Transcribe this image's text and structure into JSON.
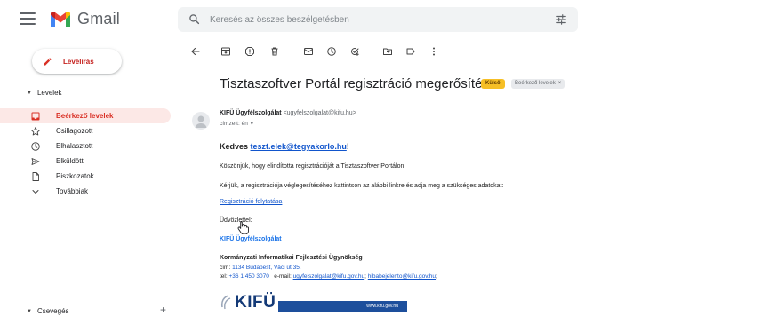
{
  "app": {
    "name": "Gmail",
    "colors": {
      "accent_red": "#d93025",
      "active_bg": "#fce8e6",
      "link": "#1155cc",
      "badge_external": "#f6bf26"
    }
  },
  "search": {
    "placeholder": "Keresés az összes beszélgetésben",
    "value": ""
  },
  "compose": {
    "label": "Levélírás"
  },
  "sidebar": {
    "section_title": "Levelek",
    "items": [
      {
        "label": "Beérkező levelek",
        "icon": "inbox-icon",
        "active": true
      },
      {
        "label": "Csillagozott",
        "icon": "star-icon",
        "active": false
      },
      {
        "label": "Elhalasztott",
        "icon": "clock-icon",
        "active": false
      },
      {
        "label": "Elküldött",
        "icon": "send-icon",
        "active": false
      },
      {
        "label": "Piszkozatok",
        "icon": "draft-icon",
        "active": false
      },
      {
        "label": "Továbbiak",
        "icon": "chevron-down-icon",
        "active": false
      }
    ],
    "chat_title": "Csevegés",
    "chat_add": "+"
  },
  "toolbar": {
    "icons": [
      "back-arrow-icon",
      "archive-icon",
      "report-spam-icon",
      "delete-icon",
      "mark-unread-icon",
      "snooze-icon",
      "add-task-icon",
      "move-to-icon",
      "label-icon",
      "more-icon"
    ]
  },
  "email": {
    "subject": "Tisztaszoftver Portál regisztráció megerősítése",
    "badge_external": "Külső",
    "badge_label": "Beérkező levelek",
    "badge_close": "×",
    "sender_name": "KIFÜ Ügyfélszolgálat",
    "sender_email": "<ugyfelszolgalat@kifu.hu>",
    "recipient_prefix": "címzett:",
    "recipient": "én",
    "greeting_prefix": "Kedves ",
    "greeting_email": "teszt.elek@tegyakorlo.hu",
    "greeting_suffix": "!",
    "line1": "Köszönjük, hogy elindította regisztrációját a Tisztaszoftver Portálon!",
    "line2": "Kérjük, a regisztrációja véglegesítéséhez kattintson az alábbi linkre és adja meg a szükséges adatokat:",
    "link": "Regisztráció folytatása",
    "closing": "Üdvözlettel:",
    "signature_team": "KIFÜ Ügyfélszolgálat",
    "org_name": "Kormányzati Informatikai Fejlesztési Ügynökség",
    "address_label": "cím:",
    "address": "1134 Budapest, Váci út 35.",
    "phone_label": "tel:",
    "phone": "+36 1 450 3070",
    "email_label": "e-mail:",
    "email1": "ugyfelszolgalat@kifu.gov.hu",
    "email_sep": ";",
    "email2": "hibabejelento@kifu.gov.hu",
    "email_end": ";",
    "logo_text": "KIFÜ",
    "banner_url": "www.kifu.gov.hu"
  }
}
